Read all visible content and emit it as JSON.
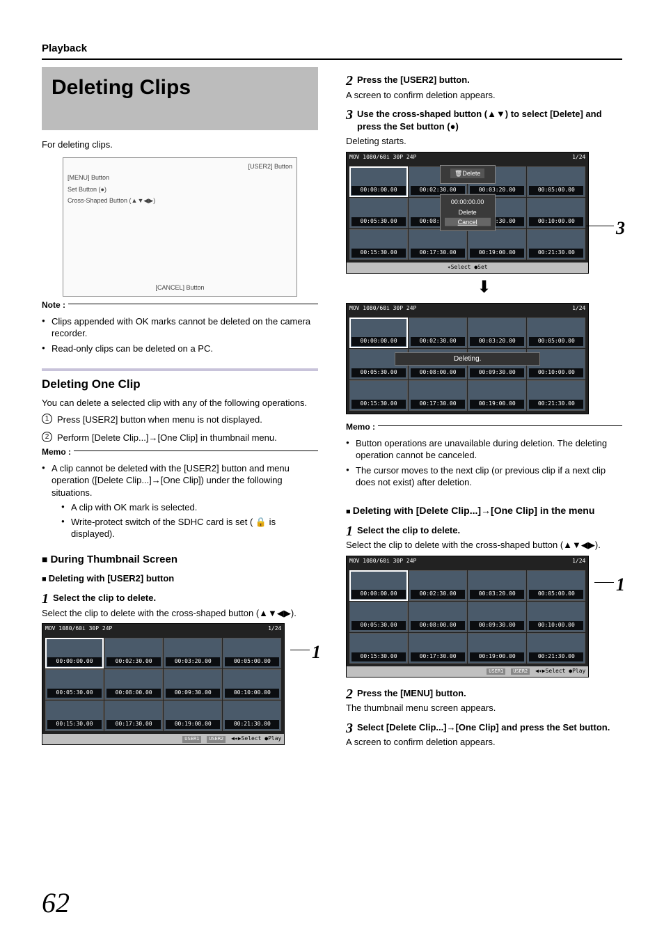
{
  "header": "Playback",
  "title": "Deleting Clips",
  "intro": "For deleting clips.",
  "illus": {
    "user2": "[USER2] Button",
    "menu": "[MENU] Button",
    "set": "Set Button (●)",
    "cross": "Cross-Shaped Button (▲▼◀▶)",
    "cancel": "[CANCEL] Button"
  },
  "note1_title": "Note :",
  "note1_items": [
    "Clips appended with OK marks cannot be deleted on the camera recorder.",
    "Read-only clips can be deleted on a PC."
  ],
  "h2_one": "Deleting One Clip",
  "one_intro": "You can delete a selected clip with any of the following operations.",
  "one_ops": [
    "Press [USER2] button when menu is not displayed.",
    "Perform [Delete Clip...]→[One Clip] in thumbnail menu."
  ],
  "memo1_title": "Memo :",
  "memo1_lead": "A clip cannot be deleted with the [USER2] button and menu operation ([Delete Clip...]→[One Clip]) under the following situations.",
  "memo1_sub": [
    "A clip with OK mark is selected.",
    "Write-protect switch of the SDHC card is set ( 🔒 is displayed)."
  ],
  "h3_thumb": "During Thumbnail Screen",
  "h4_user2": "Deleting with [USER2] button",
  "left_steps": {
    "s1_head": "Select the clip to delete.",
    "s1_body": "Select the clip to delete with the cross-shaped button (▲▼◀▶)."
  },
  "grid": {
    "top_left": "MOV   1080/60i 30P 24P",
    "top_right": "1/24",
    "tcs": [
      "00:00:00.00",
      "00:02:30.00",
      "00:03:20.00",
      "00:05:00.00",
      "00:05:30.00",
      "00:08:00.00",
      "00:09:30.00",
      "00:10:00.00",
      "00:15:30.00",
      "00:17:30.00",
      "00:19:00.00",
      "00:21:30.00"
    ],
    "bottom_tags": [
      "USER1",
      "USER2"
    ],
    "bottom_right": "◀✦▶Select   ●Play",
    "select_bar": "✦Select    ●Set"
  },
  "right": {
    "s2_head": "Press the [USER2] button.",
    "s2_body": "A screen to confirm deletion appears.",
    "s3_head": "Use the cross-shaped button (▲▼) to select [Delete] and press the Set button (●)",
    "s3_body": "Deleting starts.",
    "dialog_title": "🗑Delete",
    "dialog_tc": "00:00:00.00",
    "dialog_delete": "Delete",
    "dialog_cancel": "Cancel",
    "deleting": "Deleting.",
    "memo2_title": "Memo :",
    "memo2_items": [
      "Button operations are unavailable during deletion. The deleting operation cannot be canceled.",
      "The cursor moves to the next clip (or previous clip if a next clip does not exist) after deletion."
    ],
    "h4_menu": "Deleting with [Delete Clip...]→[One Clip] in the menu",
    "m_s1_head": "Select the clip to delete.",
    "m_s1_body": "Select the clip to delete with the cross-shaped button (▲▼◀▶).",
    "m_s2_head": "Press the [MENU] button.",
    "m_s2_body": "The thumbnail menu screen appears.",
    "m_s3_head": "Select [Delete Clip...]→[One Clip] and press the Set button.",
    "m_s3_body": "A screen to confirm deletion appears."
  },
  "page_number": "62"
}
